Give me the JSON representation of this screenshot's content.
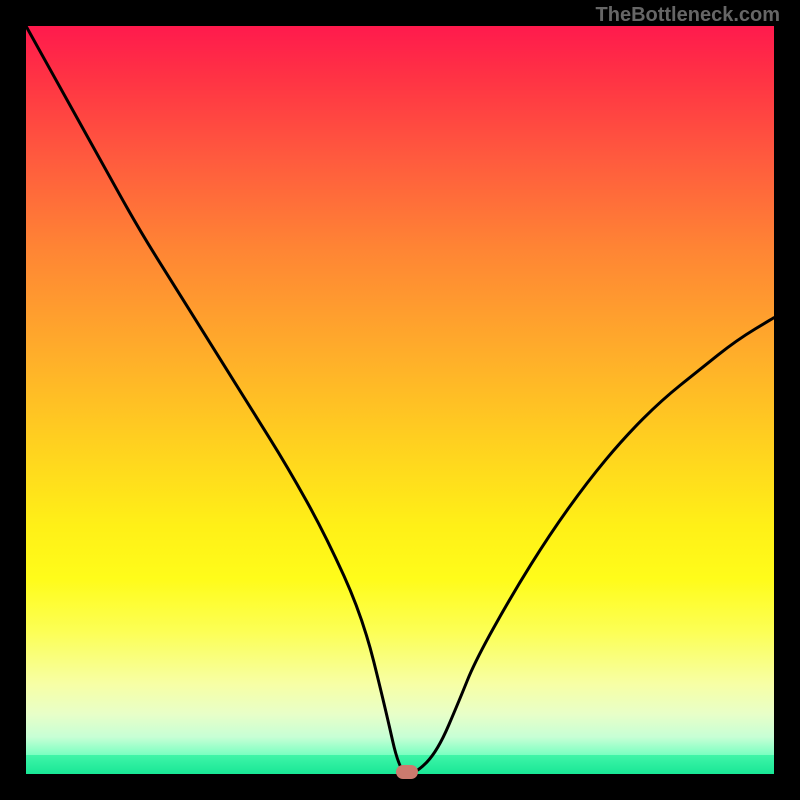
{
  "watermark": "TheBottleneck.com",
  "colors": {
    "top": "#ff1a4d",
    "mid": "#ffd21f",
    "bottom": "#18e796",
    "curve": "#000000",
    "marker": "#cc7a6e",
    "frame": "#000000"
  },
  "chart_data": {
    "type": "line",
    "title": "",
    "xlabel": "",
    "ylabel": "",
    "xlim": [
      0,
      100
    ],
    "ylim": [
      0,
      100
    ],
    "x": [
      0,
      5,
      10,
      15,
      20,
      25,
      30,
      35,
      40,
      45,
      48,
      50,
      52,
      55,
      58,
      60,
      65,
      70,
      75,
      80,
      85,
      90,
      95,
      100
    ],
    "values": [
      100,
      91,
      82,
      73,
      65,
      57,
      49,
      41,
      32,
      21,
      9,
      0,
      0,
      3,
      10,
      15,
      24,
      32,
      39,
      45,
      50,
      54,
      58,
      61
    ],
    "annotations": [
      {
        "label": "optimal-marker",
        "x": 51,
        "y": 0.3
      }
    ],
    "background_gradient_stops": [
      {
        "pos": 0,
        "color": "#ff1a4d"
      },
      {
        "pos": 50,
        "color": "#ffd21f"
      },
      {
        "pos": 88,
        "color": "#f7ffa5"
      },
      {
        "pos": 100,
        "color": "#18e796"
      }
    ]
  }
}
